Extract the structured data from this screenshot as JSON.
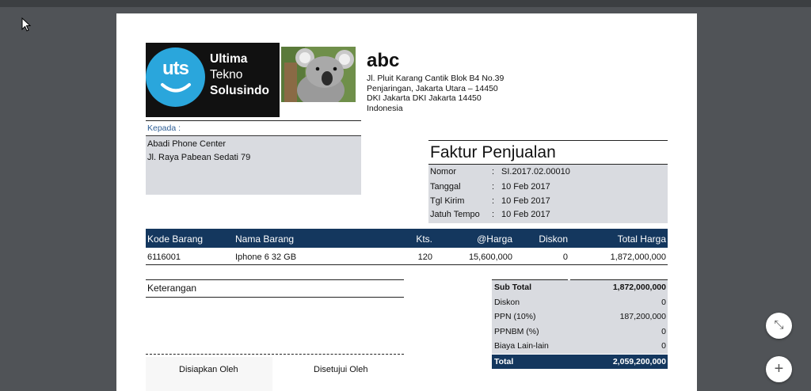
{
  "company": {
    "logo_mark": "uts",
    "logo_words": [
      "Ultima",
      "Tekno",
      "Solusindo"
    ],
    "name": "abc",
    "address": [
      "Jl. Pluit Karang Cantik Blok B4 No.39",
      "Penjaringan, Jakarta Utara – 14450",
      "DKI Jakarta DKI Jakarta 14450",
      "Indonesia"
    ]
  },
  "recipient": {
    "label": "Kepada :",
    "name": "Abadi Phone Center",
    "address": "Jl. Raya Pabean Sedati 79"
  },
  "invoice": {
    "title": "Faktur Penjualan",
    "fields": [
      {
        "label": "Nomor",
        "value": "SI.2017.02.00010"
      },
      {
        "label": "Tanggal",
        "value": "10 Feb 2017"
      },
      {
        "label": "Tgl Kirim",
        "value": "10 Feb 2017"
      },
      {
        "label": "Jatuh Tempo",
        "value": "10 Feb 2017"
      }
    ]
  },
  "table": {
    "headers": [
      "Kode Barang",
      "Nama Barang",
      "Kts.",
      "@Harga",
      "Diskon",
      "Total Harga"
    ],
    "rows": [
      [
        "6116001",
        "Iphone 6  32 GB",
        "120",
        "15,600,000",
        "0",
        "1,872,000,000"
      ]
    ]
  },
  "notes": {
    "label": "Keterangan"
  },
  "signatures": {
    "prepared": "Disiapkan Oleh",
    "approved": "Disetujui Oleh"
  },
  "summary": {
    "rows": [
      {
        "label": "Sub Total",
        "value": "1,872,000,000"
      },
      {
        "label": "Diskon",
        "value": "0"
      },
      {
        "label": "PPN (10%)",
        "value": "187,200,000"
      },
      {
        "label": "PPNBM (%)",
        "value": "0"
      },
      {
        "label": "Biaya Lain-lain",
        "value": "0"
      }
    ],
    "total": {
      "label": "Total",
      "value": "2,059,200,000"
    }
  },
  "viewer": {
    "fit_icon": "collapse-arrows-icon",
    "zoom_icon": "plus-icon",
    "fit_glyph": "⤡",
    "zoom_glyph": "+"
  },
  "colors": {
    "header_bg": "#14375e",
    "box_bg": "#d9dbe0",
    "logo_circle": "#2aa6dc"
  }
}
